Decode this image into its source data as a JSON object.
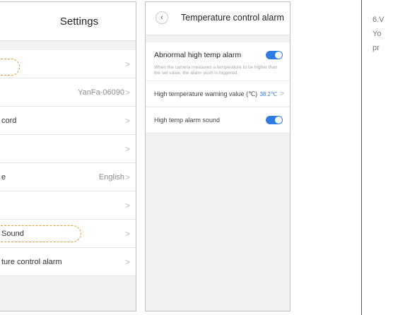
{
  "settings_screen": {
    "title": "Settings",
    "rows": [
      {
        "label": "",
        "value": ""
      },
      {
        "label": "",
        "value": "YanFa-06090"
      },
      {
        "label": "cord",
        "value": ""
      },
      {
        "label": "",
        "value": ""
      },
      {
        "label": "e",
        "value": "English"
      },
      {
        "label": "",
        "value": ""
      },
      {
        "label": "Sound",
        "value": ""
      },
      {
        "label": "ture control alarm",
        "value": ""
      }
    ]
  },
  "temp_screen": {
    "title": "Temperature control alarm",
    "back_icon": "chevron-left-icon",
    "alarm_title": "Abnormal high temp alarm",
    "alarm_desc": "When the camera measures a temperature to be higher than the set value, the alarm push is triggered.",
    "alarm_enabled": true,
    "warning_label": "High temperature warning value (℃)",
    "warning_value": "38.2℃",
    "sound_label": "High temp alarm sound",
    "sound_enabled": true,
    "accent_color": "#2f7ce0"
  },
  "side_text": {
    "line1": "6.V",
    "line2": "Yo",
    "line3": "pr"
  }
}
